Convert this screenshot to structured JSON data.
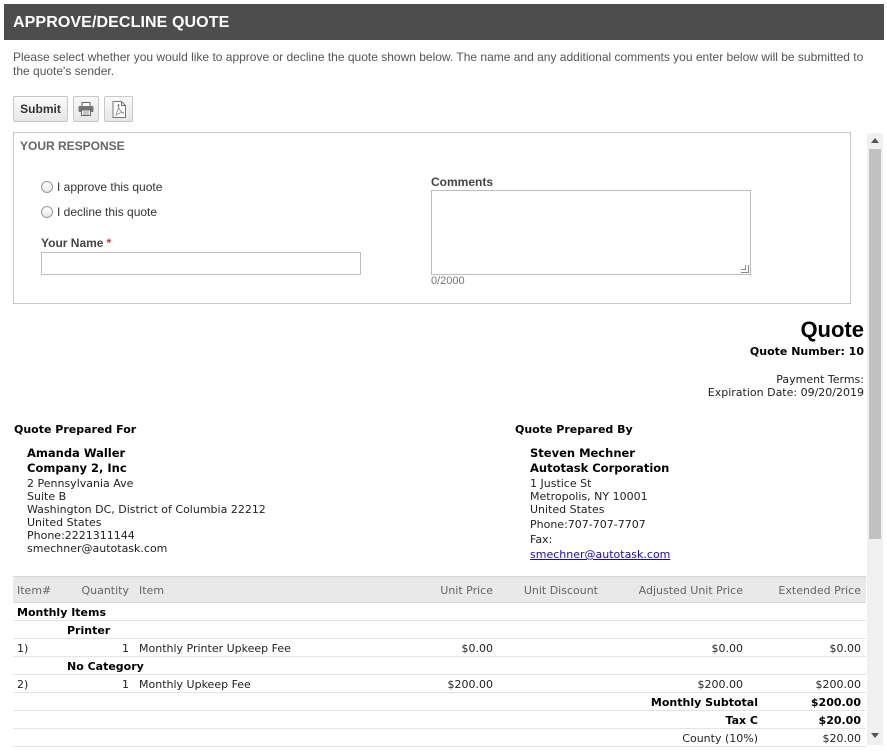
{
  "header": {
    "title": "APPROVE/DECLINE QUOTE"
  },
  "instructions": "Please select whether you would like to approve or decline the quote shown below. The name and any additional comments you enter below will be submitted to the quote's sender.",
  "toolbar": {
    "submit_label": "Submit",
    "print_icon": "printer-icon",
    "pdf_icon": "pdf-icon"
  },
  "response": {
    "title": "YOUR RESPONSE",
    "approve_label": "I approve this quote",
    "decline_label": "I decline this quote",
    "name_label": "Your Name",
    "required_marker": "*",
    "name_value": "",
    "comments_label": "Comments",
    "comments_value": "",
    "char_count": "0/2000"
  },
  "quote": {
    "title": "Quote",
    "number": "Quote Number: 10",
    "payment_terms": "Payment Terms:",
    "expiration": "Expiration Date: 09/20/2019",
    "prepared_for": {
      "heading": "Quote Prepared For",
      "name": "Amanda Waller",
      "company": "Company 2, Inc",
      "lines": [
        "2 Pennsylvania Ave",
        "Suite B",
        "Washington DC, District of Columbia 22212",
        "United States",
        "Phone:2221311144",
        "smechner@autotask.com"
      ]
    },
    "prepared_by": {
      "heading": "Quote Prepared By",
      "name": "Steven Mechner",
      "company": "Autotask Corporation",
      "lines": [
        "1 Justice St",
        "Metropolis, NY 10001",
        "United States",
        "Phone:707-707-7707",
        "Fax:"
      ],
      "email": "smechner@autotask.com"
    }
  },
  "items_table": {
    "columns": [
      "Item#",
      "Quantity",
      "Item",
      "Unit Price",
      "Unit Discount",
      "Adjusted Unit Price",
      "Extended Price"
    ],
    "group": "Monthly Items",
    "categories": [
      {
        "name": "Printer",
        "row": {
          "num": "1)",
          "qty": "1",
          "item": "Monthly Printer Upkeep Fee",
          "unit_price": "$0.00",
          "discount": "",
          "adjusted": "$0.00",
          "extended": "$0.00"
        }
      },
      {
        "name": "No Category",
        "row": {
          "num": "2)",
          "qty": "1",
          "item": "Monthly Upkeep Fee",
          "unit_price": "$200.00",
          "discount": "",
          "adjusted": "$200.00",
          "extended": "$200.00"
        }
      }
    ],
    "subtotal_label": "Monthly Subtotal",
    "subtotal_value": "$200.00",
    "tax_label": "Tax C",
    "tax_value": "$20.00",
    "county_label": "County (10%)",
    "county_value": "$20.00"
  }
}
